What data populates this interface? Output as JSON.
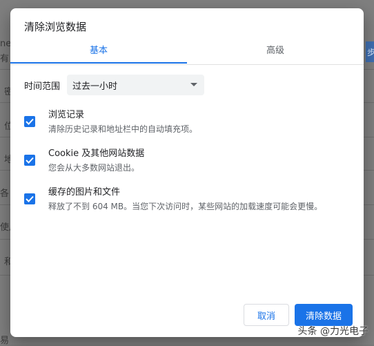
{
  "background": {
    "fragments": [
      "ne",
      "有",
      "密",
      "位",
      "地",
      "各",
      "使用",
      "和",
      "易"
    ],
    "right_button_text": "步"
  },
  "dialog": {
    "title": "清除浏览数据",
    "tabs": [
      {
        "label": "基本",
        "active": true
      },
      {
        "label": "高级",
        "active": false
      }
    ],
    "time_range": {
      "label": "时间范围",
      "selected": "过去一小时"
    },
    "options": [
      {
        "title": "浏览记录",
        "description": "清除历史记录和地址栏中的自动填充项。",
        "checked": true
      },
      {
        "title": "Cookie 及其他网站数据",
        "description": "您会从大多数网站退出。",
        "checked": true
      },
      {
        "title": "缓存的图片和文件",
        "description": "释放了不到 604 MB。当您下次访问时，某些网站的加载速度可能会更慢。",
        "checked": true
      }
    ],
    "buttons": {
      "cancel": "取消",
      "clear": "清除数据"
    }
  },
  "watermark": "头条 @力光电子",
  "colors": {
    "accent": "#1a73e8",
    "overlay": "#7f7f7f"
  }
}
